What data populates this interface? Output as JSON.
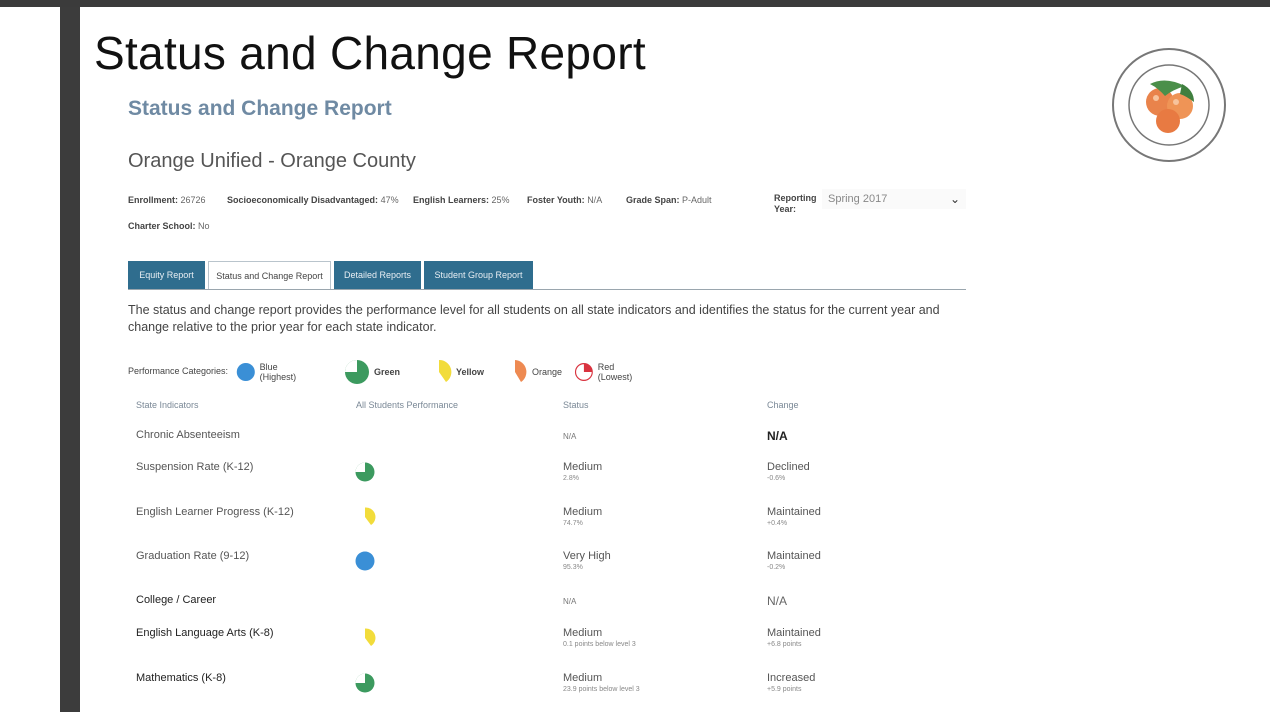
{
  "slide_title": "Status and Change Report",
  "report": {
    "heading": "Status and Change Report",
    "district": "Orange Unified - Orange County"
  },
  "meta": {
    "enrollment_label": "Enrollment:",
    "enrollment": "26726",
    "sed_label": "Socioeconomically Disadvantaged:",
    "sed": "47%",
    "el_label": "English Learners:",
    "el": "25%",
    "foster_label": "Foster Youth:",
    "foster": "N/A",
    "grade_label": "Grade Span:",
    "grade": "P-Adult",
    "charter_label": "Charter School:",
    "charter": "No",
    "reporting_label": "Reporting Year:",
    "reporting_value": "Spring 2017"
  },
  "tabs": [
    {
      "label": "Equity Report"
    },
    {
      "label": "Status and Change Report"
    },
    {
      "label": "Detailed Reports"
    },
    {
      "label": "Student Group Report"
    }
  ],
  "description": "The status and change report provides the performance level for all students on all state indicators and identifies the status for the current year and change relative to the prior year for each state indicator.",
  "legend": {
    "label": "Performance Categories:",
    "items": [
      {
        "text": "Blue (Highest)",
        "color": "#3a8fd6",
        "icon": "blue-performance-icon"
      },
      {
        "text": "Green",
        "color": "#3c9a5f",
        "icon": "green-performance-icon"
      },
      {
        "text": "Yellow",
        "color": "#f2dc3b",
        "icon": "yellow-performance-icon"
      },
      {
        "text": "Orange",
        "color": "#ee8a52",
        "icon": "orange-performance-icon"
      },
      {
        "text": "Red (Lowest)",
        "color": "#d9333f",
        "icon": "red-performance-icon"
      }
    ]
  },
  "table": {
    "headers": [
      "State Indicators",
      "All Students Performance",
      "Status",
      "Change"
    ],
    "rows": [
      {
        "indicator": "Chronic Absenteeism",
        "performance": "",
        "status": "N/A",
        "status_sub": "",
        "change": "N/A",
        "change_sub": ""
      },
      {
        "indicator": "Suspension Rate (K-12)",
        "performance": "green",
        "status": "Medium",
        "status_sub": "2.8%",
        "change": "Declined",
        "change_sub": "-0.6%"
      },
      {
        "indicator": "English Learner Progress (K-12)",
        "performance": "yellow",
        "status": "Medium",
        "status_sub": "74.7%",
        "change": "Maintained",
        "change_sub": "+0.4%"
      },
      {
        "indicator": "Graduation Rate (9-12)",
        "performance": "blue",
        "status": "Very High",
        "status_sub": "95.3%",
        "change": "Maintained",
        "change_sub": "-0.2%"
      },
      {
        "indicator": "College / Career",
        "performance": "",
        "status": "N/A",
        "status_sub": "",
        "change": "N/A",
        "change_sub": ""
      },
      {
        "indicator": "English Language Arts (K-8)",
        "performance": "yellow",
        "status": "Medium",
        "status_sub": "0.1 points below level 3",
        "change": "Maintained",
        "change_sub": "+6.8 points"
      },
      {
        "indicator": "Mathematics (K-8)",
        "performance": "green",
        "status": "Medium",
        "status_sub": "23.9 points below level 3",
        "change": "Increased",
        "change_sub": "+5.9 points"
      }
    ]
  }
}
